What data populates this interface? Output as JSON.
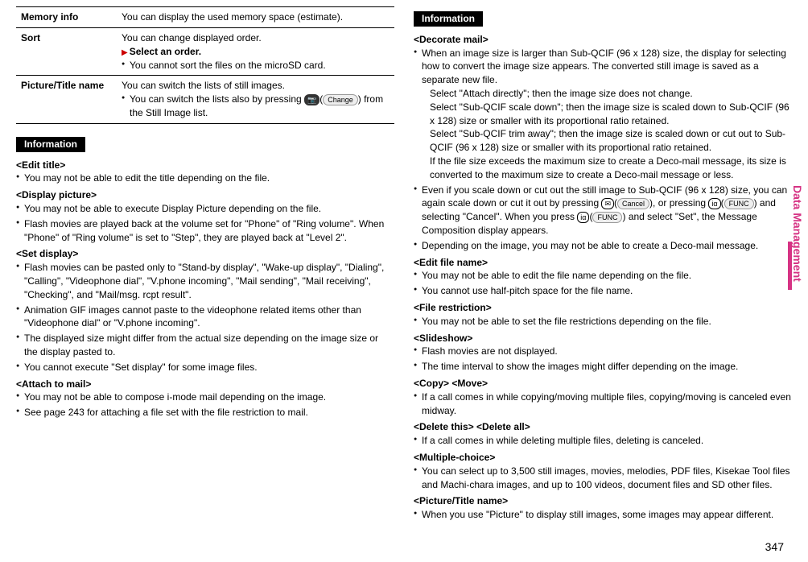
{
  "page_number": "347",
  "side_tab": "Data Management",
  "table": {
    "rows": [
      {
        "label": "Memory info",
        "lines": [
          {
            "text": "You can display the used memory space (estimate)."
          }
        ]
      },
      {
        "label": "Sort",
        "lines": [
          {
            "text": "You can change displayed order."
          },
          {
            "tri": true,
            "bold": true,
            "text": "Select an order."
          },
          {
            "bullet": true,
            "text": "You cannot sort the files on the microSD card."
          }
        ]
      },
      {
        "label": "Picture/Title name",
        "lines": [
          {
            "text": "You can switch the lists of still images."
          },
          {
            "bullet": true,
            "segments": [
              {
                "text": "You can switch the lists also by pressing "
              },
              {
                "icon": "camera-button-icon",
                "dark": true,
                "glyph": "📷"
              },
              {
                "text": "("
              },
              {
                "label": "Change"
              },
              {
                "text": ") from the Still Image list."
              }
            ]
          }
        ]
      }
    ]
  },
  "left": {
    "header": "Information",
    "sections": [
      {
        "title": "<Edit title>",
        "items": [
          {
            "text": "You may not be able to edit the title depending on the file."
          }
        ]
      },
      {
        "title": "<Display picture>",
        "items": [
          {
            "text": "You may not be able to execute Display Picture depending on the file."
          },
          {
            "text": "Flash movies are played back at the volume set for \"Phone\" of \"Ring volume\". When \"Phone\" of \"Ring volume\" is set to \"Step\", they are played back at \"Level 2\"."
          }
        ]
      },
      {
        "title": "<Set display>",
        "items": [
          {
            "text": "Flash movies can be pasted only to \"Stand-by display\", \"Wake-up display\", \"Dialing\", \"Calling\", \"Videophone dial\", \"V.phone incoming\", \"Mail sending\", \"Mail receiving\", \"Checking\", and \"Mail/msg. rcpt result\"."
          },
          {
            "text": "Animation GIF images cannot paste to the videophone related items other than \"Videophone dial\" or \"V.phone incoming\"."
          },
          {
            "text": "The displayed size might differ from the actual size depending on the image size or the display pasted to."
          },
          {
            "text": "You cannot execute \"Set display\" for some image files."
          }
        ]
      },
      {
        "title": "<Attach to mail>",
        "items": [
          {
            "text": "You may not be able to compose i-mode mail depending on the image."
          },
          {
            "text": "See page 243 for attaching a file set with the file restriction to mail."
          }
        ]
      }
    ]
  },
  "right": {
    "header": "Information",
    "sections": [
      {
        "title": "<Decorate mail>",
        "items": [
          {
            "text": "When an image size is larger than Sub-QCIF (96 x 128) size, the display for selecting how to convert the image size appears. The converted still image is saved as a separate new file.",
            "subs": [
              "Select \"Attach directly\"; then the image size does not change.",
              "Select \"Sub-QCIF scale down\"; then the image size is scaled down to Sub-QCIF (96 x 128) size or smaller with its proportional ratio retained.",
              "Select \"Sub-QCIF trim away\"; then the image size is scaled down or cut out to Sub-QCIF (96 x 128) size or smaller with its proportional ratio retained.",
              "If the file size exceeds the maximum size to create a Deco-mail message, its size is converted to the maximum size to create a Deco-mail message or less."
            ]
          },
          {
            "segments": [
              {
                "text": "Even if you scale down or cut out the still image to Sub-QCIF (96 x 128) size, you can again scale down or cut it out by pressing "
              },
              {
                "icon": "mail-button-icon",
                "glyph": "✉"
              },
              {
                "text": "("
              },
              {
                "label": "Cancel"
              },
              {
                "text": "), or pressing "
              },
              {
                "icon": "ir-button-icon",
                "glyph": "iα"
              },
              {
                "text": "("
              },
              {
                "label": "FUNC"
              },
              {
                "text": ") and selecting \"Cancel\". When you press "
              },
              {
                "icon": "ir-button-icon",
                "glyph": "iα"
              },
              {
                "text": "("
              },
              {
                "label": "FUNC"
              },
              {
                "text": ") and select \"Set\", the Message Composition display appears."
              }
            ]
          },
          {
            "text": "Depending on the image, you may not be able to create a Deco-mail message."
          }
        ]
      },
      {
        "title": "<Edit file name>",
        "items": [
          {
            "text": "You may not be able to edit the file name depending on the file."
          },
          {
            "text": "You cannot use half-pitch space for the file name."
          }
        ]
      },
      {
        "title": "<File restriction>",
        "items": [
          {
            "text": "You may not be able to set the file restrictions depending on the file."
          }
        ]
      },
      {
        "title": "<Slideshow>",
        "items": [
          {
            "text": "Flash movies are not displayed."
          },
          {
            "text": "The time interval to show the images might differ depending on the image."
          }
        ]
      },
      {
        "title": "<Copy> <Move>",
        "items": [
          {
            "text": "If a call comes in while copying/moving multiple files, copying/moving is canceled even midway."
          }
        ]
      },
      {
        "title": "<Delete this> <Delete all>",
        "items": [
          {
            "text": "If a call comes in while deleting multiple files, deleting is canceled."
          }
        ]
      },
      {
        "title": "<Multiple-choice>",
        "items": [
          {
            "text": "You can select up to 3,500 still images, movies, melodies, PDF files, Kisekae Tool files and Machi-chara images, and up to 100 videos, document files and SD other files."
          }
        ]
      },
      {
        "title": "<Picture/Title name>",
        "items": [
          {
            "text": "When you use \"Picture\" to display still images, some images may appear different."
          }
        ]
      }
    ]
  }
}
